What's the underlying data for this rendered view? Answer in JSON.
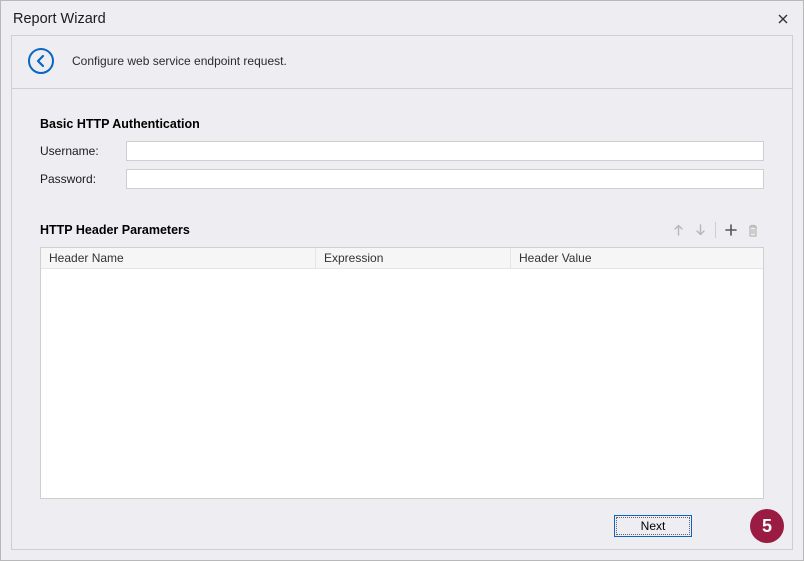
{
  "window": {
    "title": "Report Wizard"
  },
  "banner": {
    "text": "Configure web service endpoint request."
  },
  "auth": {
    "section_title": "Basic HTTP Authentication",
    "username_label": "Username:",
    "username_value": "",
    "password_label": "Password:",
    "password_value": ""
  },
  "headers": {
    "section_title": "HTTP Header Parameters",
    "columns": {
      "name": "Header Name",
      "expression": "Expression",
      "value": "Header Value"
    }
  },
  "footer": {
    "next": "Next"
  },
  "badge": {
    "number": "5"
  },
  "icons": {
    "close": "close-icon",
    "back": "back-arrow-icon",
    "move_up": "arrow-up-icon",
    "move_down": "arrow-down-icon",
    "add": "plus-icon",
    "delete": "trash-icon"
  }
}
